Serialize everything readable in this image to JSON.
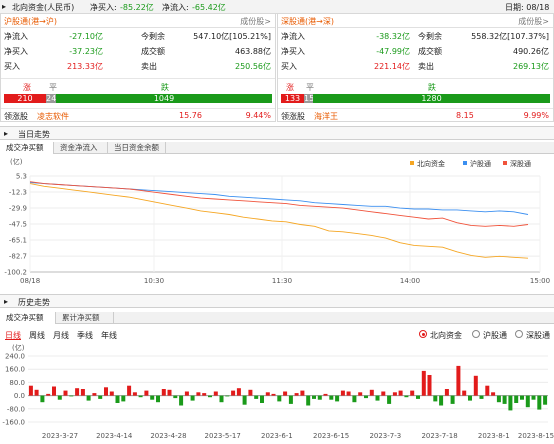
{
  "topbar": {
    "title": "北向资金(人民币)",
    "net_buy_label": "净买入:",
    "net_buy_value": "-85.22亿",
    "net_inflow_label": "净流入:",
    "net_inflow_value": "-65.42亿",
    "date": "日期: 08/18"
  },
  "sh": {
    "title": "沪股通(港→沪)",
    "link": "成份股>",
    "r1": [
      "净流入",
      "-27.10亿",
      "今剩余",
      "547.10亿[105.21%]"
    ],
    "r2": [
      "净买入",
      "-37.23亿",
      "成交额",
      "463.88亿"
    ],
    "r3": [
      "买入",
      "213.33亿",
      "卖出",
      "250.56亿"
    ],
    "up_label": "涨",
    "flat_label": "平",
    "down_label": "跌",
    "up": "210",
    "flat": "24",
    "down": "1049",
    "lead_label": "领涨股",
    "lead_name": "凌志软件",
    "lead_price": "15.76",
    "lead_pct": "9.44%"
  },
  "sz": {
    "title": "深股通(港→深)",
    "link": "成份股>",
    "r1": [
      "净流入",
      "-38.32亿",
      "今剩余",
      "558.32亿[107.37%]"
    ],
    "r2": [
      "净买入",
      "-47.99亿",
      "成交额",
      "490.26亿"
    ],
    "r3": [
      "买入",
      "221.14亿",
      "卖出",
      "269.13亿"
    ],
    "up_label": "涨",
    "flat_label": "平",
    "down_label": "跌",
    "up": "133",
    "flat": "15",
    "down": "1280",
    "lead_label": "领涨股",
    "lead_name": "海洋王",
    "lead_price": "8.15",
    "lead_pct": "9.99%"
  },
  "intraday": {
    "section": "当日走势",
    "tabs": [
      "成交净买额",
      "资金净流入",
      "当日资金余额"
    ],
    "unit": "(亿)",
    "legend": [
      "北向资金",
      "沪股通",
      "深股通"
    ]
  },
  "history": {
    "section": "历史走势",
    "tabs": [
      "成交净买额",
      "累计净买额"
    ],
    "unit": "(亿)",
    "periods": [
      "日线",
      "周线",
      "月线",
      "季线",
      "年线"
    ],
    "radios": [
      "北向资金",
      "沪股通",
      "深股通"
    ]
  },
  "colors": {
    "north": "#f5a623",
    "sh": "#3b8ff0",
    "sz": "#f0533b",
    "up": "#e21b1b",
    "down": "#1a9a1a"
  },
  "chart_data": [
    {
      "type": "line",
      "title": "",
      "ylabel": "(亿)",
      "yticks": [
        5.3,
        -12.3,
        -29.9,
        -47.5,
        -65.1,
        -82.7,
        -100.2
      ],
      "ylim": [
        -100.2,
        5.3
      ],
      "xticks": [
        "08/18",
        "10:30",
        "11:30",
        "14:00",
        "15:00"
      ],
      "series": [
        {
          "name": "北向资金",
          "values": [
            -3,
            -6,
            -8,
            -10,
            -12,
            -14,
            -16,
            -18,
            -21,
            -24,
            -27,
            -30,
            -33,
            -35,
            -37,
            -40,
            -42,
            -44,
            -45,
            -48,
            -50,
            -55,
            -56,
            -58,
            -60,
            -63,
            -68,
            -71,
            -72,
            -73,
            -78,
            -82,
            -84,
            -83,
            -84,
            -85
          ]
        },
        {
          "name": "沪股通",
          "values": [
            -2,
            -3,
            -4,
            -5,
            -6,
            -7,
            -8,
            -9,
            -10,
            -11,
            -12,
            -13,
            -14,
            -15,
            -17,
            -18,
            -19,
            -20,
            -21,
            -22,
            -24,
            -25,
            -26,
            -27,
            -28,
            -28,
            -30,
            -31,
            -31,
            -32,
            -32,
            -33,
            -34,
            -33,
            -34,
            -37
          ]
        },
        {
          "name": "深股通",
          "values": [
            -1,
            -3,
            -4,
            -5,
            -6,
            -7,
            -8,
            -9,
            -11,
            -13,
            -15,
            -17,
            -19,
            -20,
            -21,
            -22,
            -23,
            -24,
            -25,
            -27,
            -28,
            -29,
            -30,
            -32,
            -34,
            -36,
            -38,
            -40,
            -42,
            -41,
            -46,
            -49,
            -50,
            -49,
            -50,
            -48
          ]
        }
      ]
    },
    {
      "type": "bar",
      "title": "",
      "ylabel": "(亿)",
      "yticks": [
        240,
        160,
        80,
        0,
        -80,
        -160
      ],
      "ylim": [
        -160,
        240
      ],
      "xticks": [
        "2023-3-27",
        "2023-4-14",
        "2023-4-28",
        "2023-5-17",
        "2023-6-1",
        "2023-6-15",
        "2023-7-3",
        "2023-7-18",
        "2023-8-1",
        "2023-8-15"
      ],
      "series": [
        {
          "name": "北向资金",
          "values": [
            60,
            35,
            -40,
            10,
            55,
            -25,
            30,
            -5,
            45,
            40,
            -30,
            15,
            -20,
            50,
            25,
            -45,
            -35,
            60,
            20,
            -10,
            30,
            -25,
            -40,
            40,
            35,
            -15,
            -60,
            25,
            -30,
            20,
            15,
            -10,
            25,
            -40,
            -5,
            30,
            45,
            -55,
            35,
            -20,
            -45,
            20,
            10,
            -35,
            25,
            -50,
            15,
            30,
            -60,
            -20,
            -25,
            10,
            -25,
            -35,
            30,
            25,
            -40,
            20,
            -15,
            35,
            -30,
            25,
            -50,
            20,
            30,
            -10,
            30,
            -20,
            150,
            125,
            -35,
            -60,
            40,
            -50,
            180,
            30,
            -30,
            120,
            -20,
            60,
            20,
            -40,
            -50,
            -90,
            -45,
            -25,
            -70,
            -25,
            -85,
            -55
          ]
        }
      ]
    }
  ]
}
